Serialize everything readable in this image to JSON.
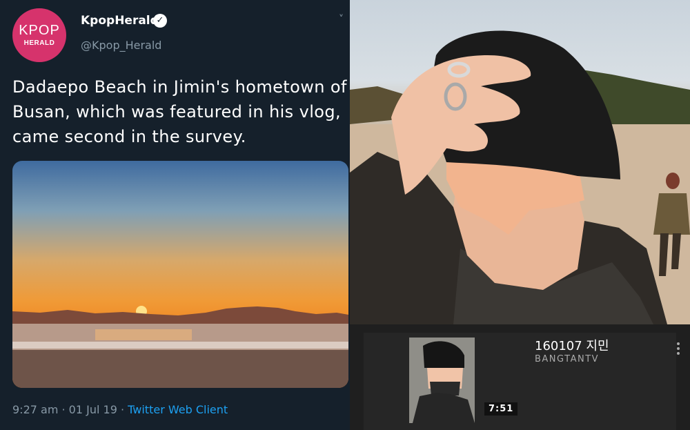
{
  "tweet": {
    "avatar_line1": "KPOP",
    "avatar_line2": "HERALD",
    "display_name": "KpopHerald",
    "verified_mark": "✓",
    "handle": "@Kpop_Herald",
    "caret": "˅",
    "text": "Dadaepo Beach in Jimin's hometown of Busan, which was featured in his vlog, came second in the survey.",
    "time": "9:27 am",
    "separator1": " · ",
    "date": "01 Jul 19",
    "separator2": " · ",
    "client": "Twitter Web Client",
    "icons": {
      "verified": "verified-badge-icon",
      "menu": "chevron-down-icon"
    }
  },
  "video_card": {
    "title": "160107 지민",
    "channel": "BANGTANTV",
    "duration": "7:51",
    "menu_icon": "more-vert-icon"
  },
  "colors": {
    "twitter_bg": "#15202b",
    "twitter_blue": "#1da1f2",
    "muted": "#8899a6",
    "brand_pink": "#d6336c",
    "youtube_bg": "#1f1f1f"
  }
}
